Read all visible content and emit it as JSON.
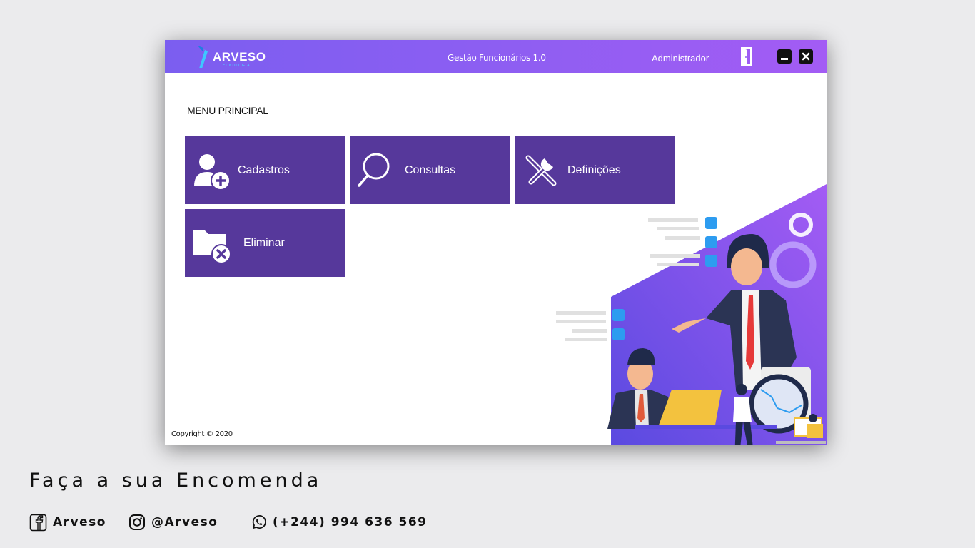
{
  "brand": {
    "name": "ARVESO",
    "tagline": "TECNOLOGIA"
  },
  "titlebar": {
    "app_title": "Gestão Funcionários 1.0",
    "user": "Administrador"
  },
  "main": {
    "heading": "MENU PRINCIPAL",
    "tiles": [
      {
        "label": "Cadastros",
        "icon": "add-user-icon"
      },
      {
        "label": "Consultas",
        "icon": "search-icon"
      },
      {
        "label": "Definições",
        "icon": "tools-icon"
      },
      {
        "label": "Eliminar",
        "icon": "delete-folder-icon"
      }
    ]
  },
  "footer": {
    "copyright": "Copyright © 2020"
  },
  "promo": {
    "title": "Faça a sua Encomenda",
    "facebook": "Arveso",
    "instagram": "@Arveso",
    "whatsapp": "(+244) 994 636 569"
  },
  "colors": {
    "titlebar_start": "#7b5ef0",
    "titlebar_end": "#a35cf4",
    "tile": "#56389b",
    "accent_blue": "#2d9cf0"
  }
}
